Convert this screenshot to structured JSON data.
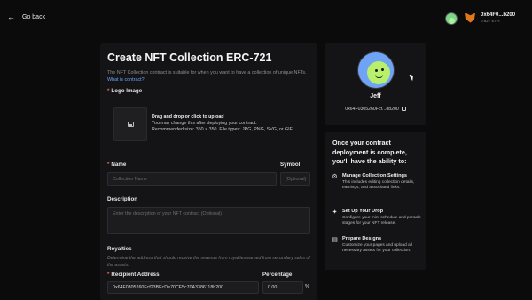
{
  "header": {
    "back_label": "Go back",
    "wallet_address": "0x64F0...b200",
    "wallet_balance": "0.627 ETH"
  },
  "form": {
    "title": "Create NFT Collection ERC-721",
    "description": "The NFT Collection contract is suitable for when you want to have a collection of unique NFTs.",
    "description_link": "What is contract?",
    "logo_label": "Logo Image",
    "logo_drop_title": "Drag and drop or click to upload",
    "logo_drop_line2": "You may change this after deploying your contract.",
    "logo_drop_line3": "Recommended size: 350 × 350. File types: JPG, PNG, SVG, or GIF",
    "name_label": "Name",
    "name_placeholder": "Collection Name",
    "symbol_label": "Symbol",
    "symbol_placeholder": "(Optional)",
    "description_label": "Description",
    "description_placeholder": "Enter the description of your NFT contract (Optional)",
    "royalties_label": "Royalties",
    "royalties_help": "Determine the address that should receive the revenue from royalties earned from secondary sales of the assets.",
    "recipient_label": "Recipient Address",
    "recipient_value": "0x64F0305260Fcf23BEcDe70CF5c70A3386118b200",
    "percentage_label": "Percentage",
    "percentage_value": "0.00",
    "percent_sign": "%"
  },
  "preview": {
    "name": "Jeff",
    "address": "0x64F0305260Fcf...8b200"
  },
  "info": {
    "title": "Once your contract deployment is complete, you'll have the ability to:",
    "features": [
      {
        "icon": "gear-icon",
        "glyph": "⚙",
        "title": "Manage Collection Settings",
        "desc": "This includes editing collection details, earnings, and associated links."
      },
      {
        "icon": "sparkle-icon",
        "glyph": "✦",
        "title": "Set Up Your Drop",
        "desc": "Configure your mint schedule and presale stages for your NFT release."
      },
      {
        "icon": "design-icon",
        "glyph": "▤",
        "title": "Prepare Designs",
        "desc": "Customize your pages and upload all necessary assets for your collection."
      }
    ]
  }
}
